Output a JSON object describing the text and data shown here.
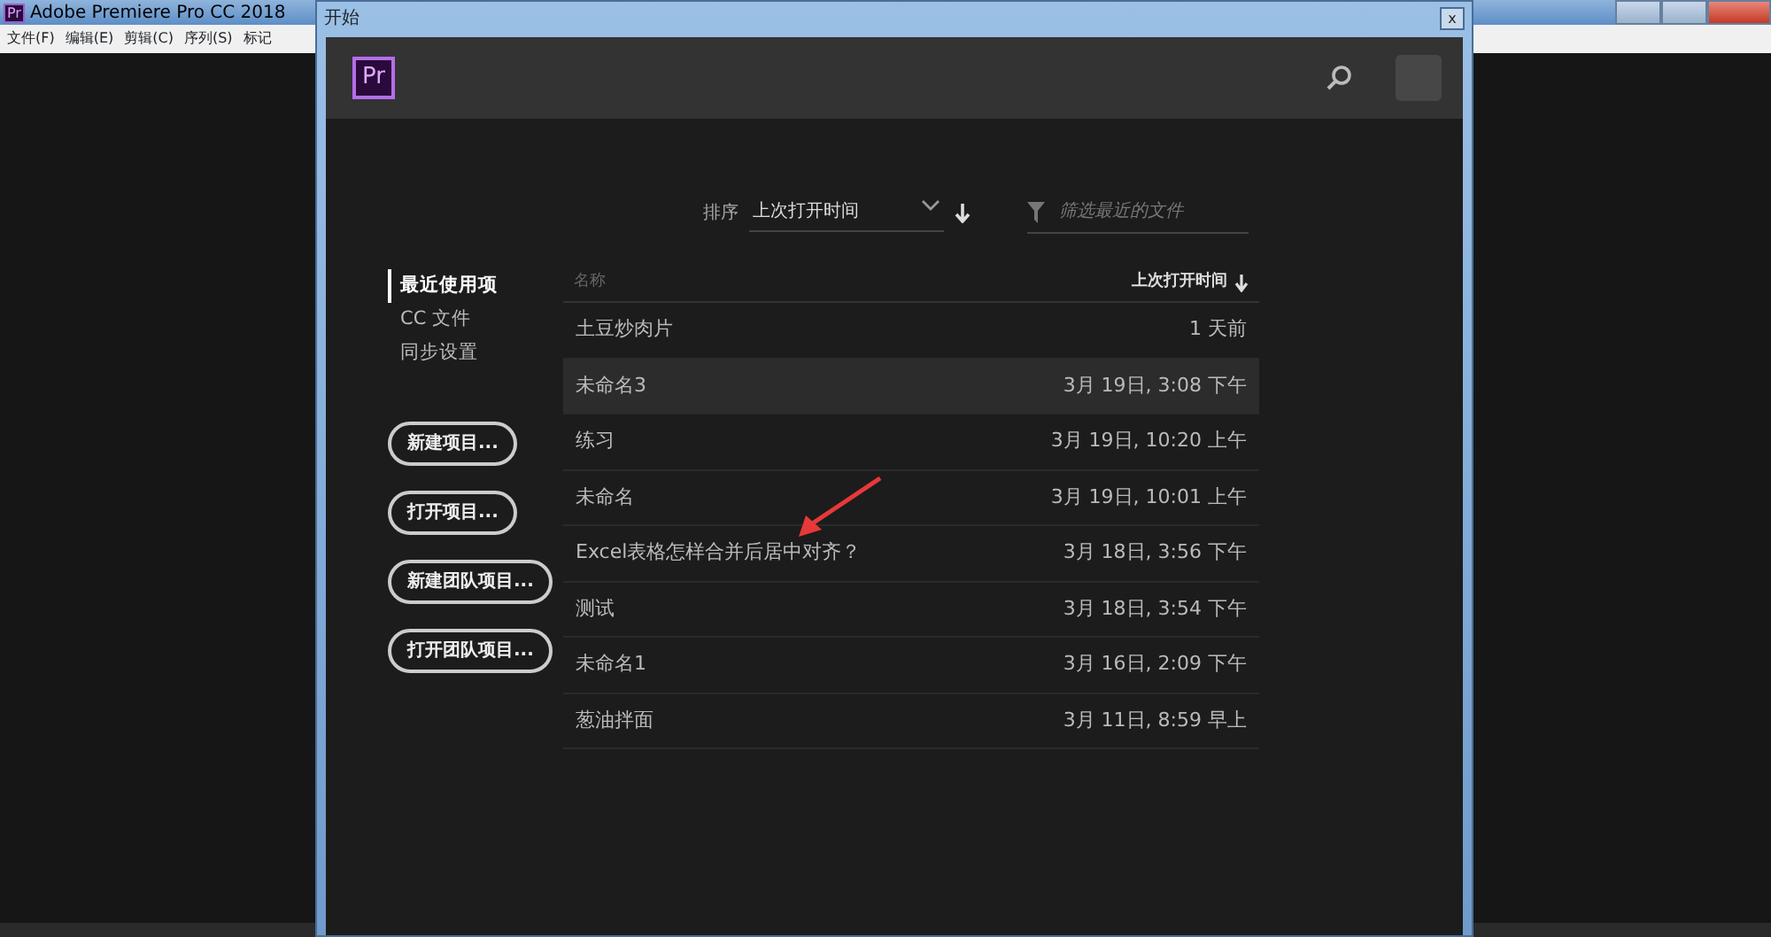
{
  "app_window": {
    "title": "Adobe Premiere Pro CC 2018",
    "logo": "Pr",
    "menu": [
      "文件(F)",
      "编辑(E)",
      "剪辑(C)",
      "序列(S)",
      "标记"
    ]
  },
  "dialog": {
    "title": "开始",
    "close": "x",
    "logo": "Pr",
    "sidebar": [
      {
        "label": "最近使用项",
        "selected": true
      },
      {
        "label": "CC 文件",
        "selected": false
      },
      {
        "label": "同步设置",
        "selected": false
      }
    ],
    "buttons": [
      "新建项目...",
      "打开项目...",
      "新建团队项目...",
      "打开团队项目..."
    ],
    "sort": {
      "label": "排序",
      "value": "上次打开时间"
    },
    "filter": {
      "placeholder": "筛选最近的文件"
    },
    "columns": [
      "名称",
      "上次打开时间"
    ],
    "rows": [
      {
        "name": "土豆炒肉片",
        "time": "1 天前",
        "selected": false
      },
      {
        "name": "未命名3",
        "time": "3月 19日, 3:08 下午",
        "selected": true
      },
      {
        "name": "练习",
        "time": "3月 19日, 10:20 上午",
        "selected": false
      },
      {
        "name": "未命名",
        "time": "3月 19日, 10:01 上午",
        "selected": false
      },
      {
        "name": "Excel表格怎样合并后居中对齐？",
        "time": "3月 18日, 3:56 下午",
        "selected": false
      },
      {
        "name": "测试",
        "time": "3月 18日, 3:54 下午",
        "selected": false
      },
      {
        "name": "未命名1",
        "time": "3月 16日, 2:09 下午",
        "selected": false
      },
      {
        "name": "葱油拌面",
        "time": "3月 11日, 8:59 早上",
        "selected": false
      }
    ]
  }
}
